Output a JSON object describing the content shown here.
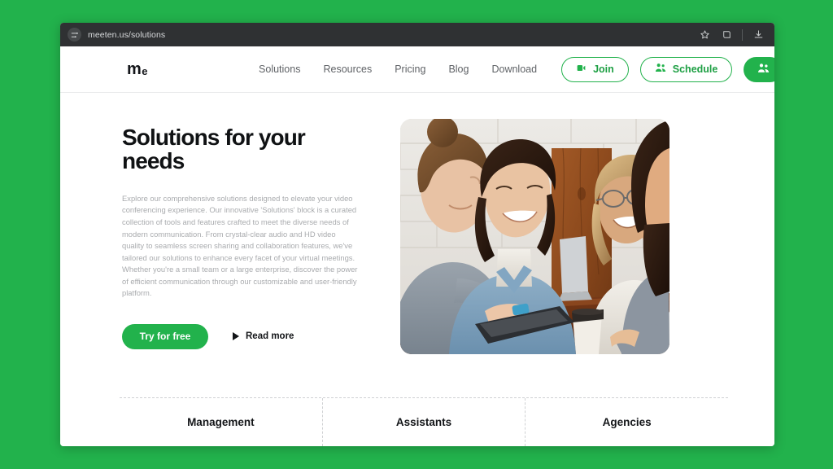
{
  "browser": {
    "url": "meeten.us/solutions",
    "site_icon": "sliders-icon",
    "bookmark_icon": "star-icon",
    "tab_icon": "window-copy-icon",
    "download_icon": "download-icon"
  },
  "site": {
    "brand": {
      "main": "m",
      "sub": "e"
    },
    "nav_links": [
      {
        "label": "Solutions"
      },
      {
        "label": "Resources"
      },
      {
        "label": "Pricing"
      },
      {
        "label": "Blog"
      },
      {
        "label": "Download"
      }
    ],
    "actions": {
      "join_label": "Join",
      "schedule_label": "Schedule",
      "join_icon": "video-camera-icon",
      "schedule_icon": "people-group-icon",
      "profile_icon": "people-group-icon"
    }
  },
  "hero": {
    "title": "Solutions for your needs",
    "body": "Explore our comprehensive solutions designed to elevate your video conferencing experience. Our innovative 'Solutions' block is a curated collection of tools and features crafted to meet the diverse needs of modern communication. From crystal-clear audio and HD video quality to seamless screen sharing and collaboration features, we've tailored our solutions to enhance every facet of your virtual meetings. Whether you're a small team or a large enterprise, discover the power of efficient communication through our customizable and user-friendly platform.",
    "primary_cta": "Try for free",
    "secondary_cta": "Read more",
    "secondary_icon": "play-triangle-icon",
    "image_alt": "four-people-meeting-photo"
  },
  "categories": [
    {
      "label": "Management"
    },
    {
      "label": "Assistants"
    },
    {
      "label": "Agencies"
    }
  ],
  "colors": {
    "page_background": "#22b24c",
    "brand_green": "#22b24c",
    "chrome": "#2f3133",
    "body_text": "#a9abae",
    "heading": "#101214"
  }
}
